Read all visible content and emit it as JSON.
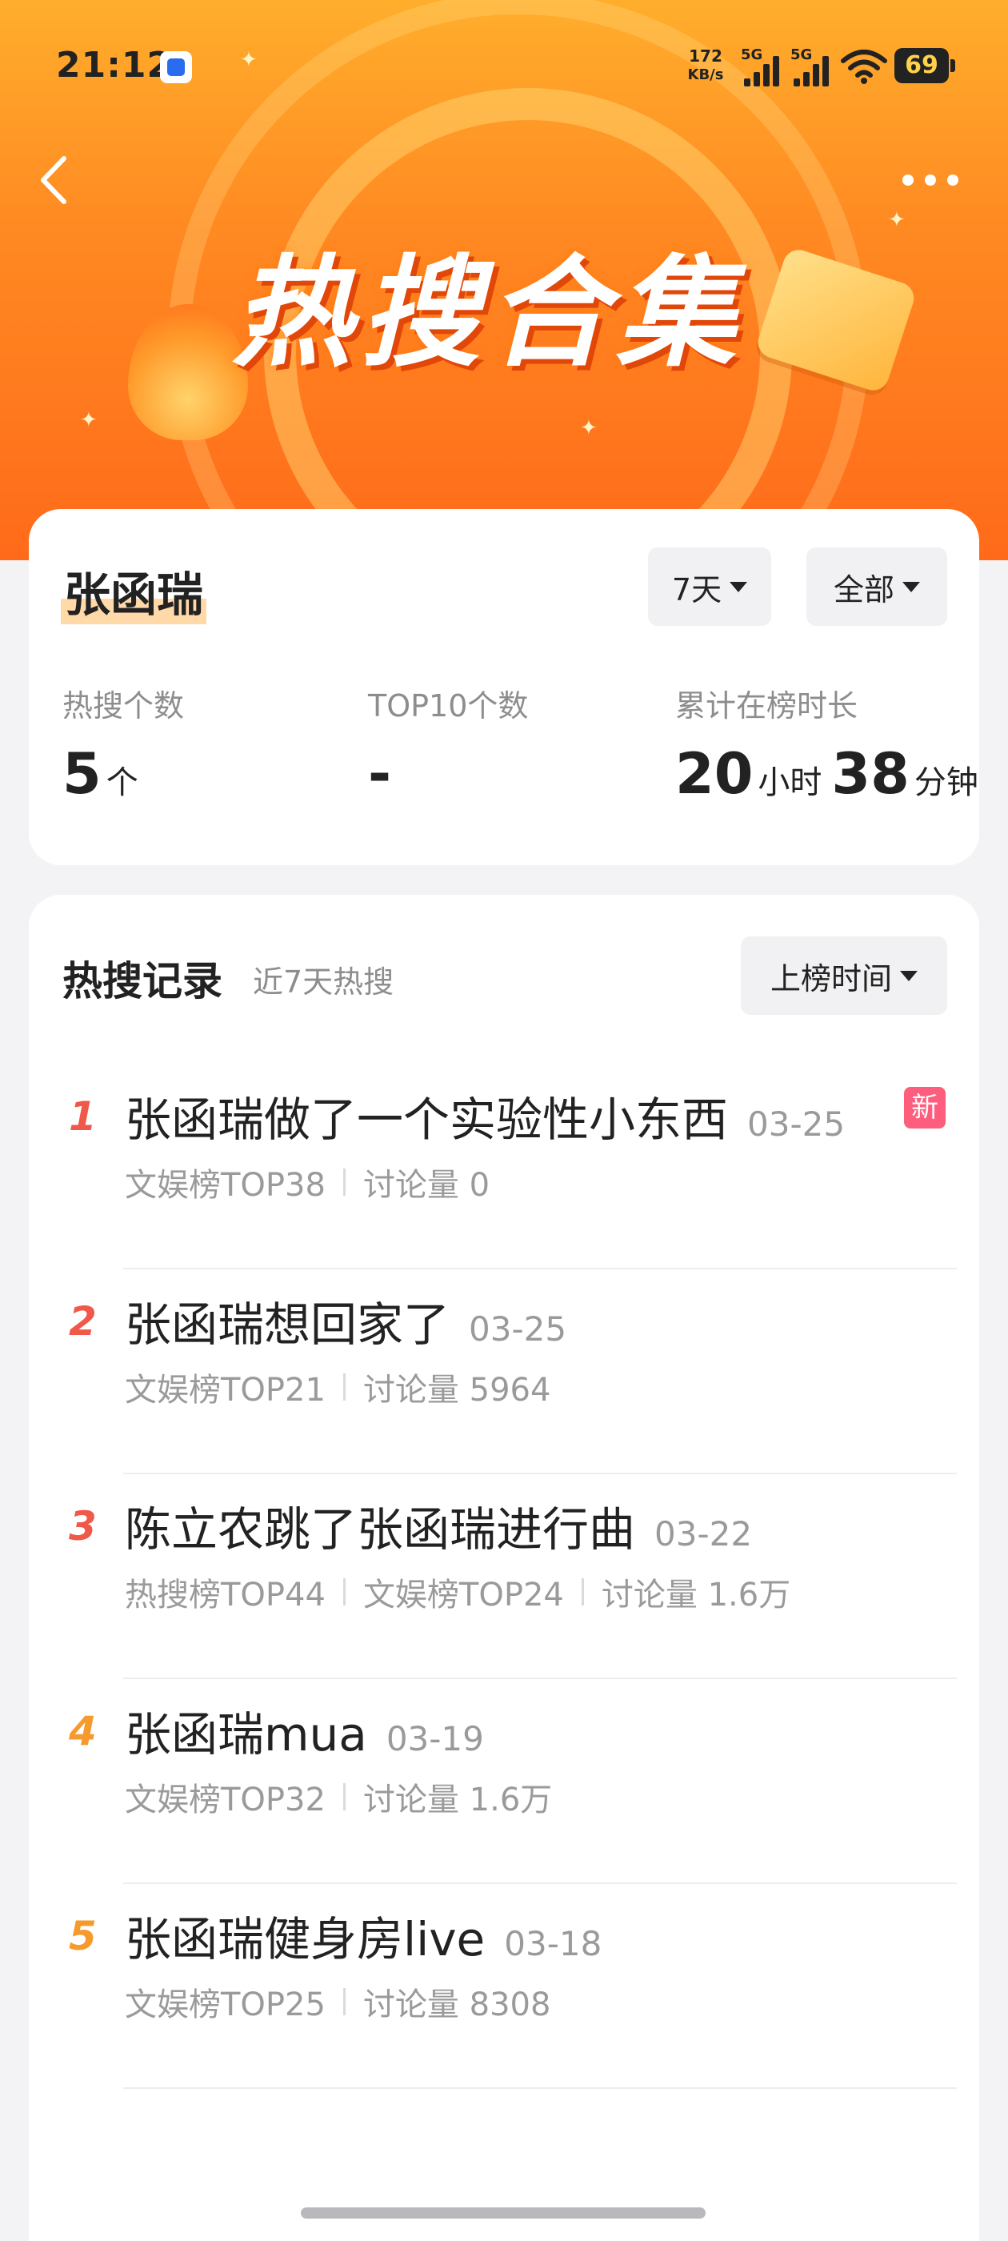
{
  "status_bar": {
    "time": "21:12",
    "net_speed": "172",
    "net_unit": "KB/s",
    "sig1": "5G",
    "sig2": "5G",
    "battery": "69"
  },
  "banner": {
    "title": "热搜合集"
  },
  "profile": {
    "name": "张函瑞",
    "range_filter": "7天",
    "type_filter": "全部",
    "stats": [
      {
        "label": "热搜个数",
        "value": "5",
        "unit": "个"
      },
      {
        "label": "TOP10个数",
        "value": "-"
      },
      {
        "label": "累计在榜时长",
        "hours": "20",
        "hours_unit": "小时",
        "minutes": "38",
        "minutes_unit": "分钟"
      }
    ]
  },
  "records": {
    "title": "热搜记录",
    "subtitle": "近7天热搜",
    "sort_label": "上榜时间",
    "items": [
      {
        "rank": "1",
        "title": "张函瑞做了一个实验性小东西",
        "date": "03-25",
        "badge": "新",
        "meta": [
          "文娱榜TOP38",
          "讨论量 0"
        ]
      },
      {
        "rank": "2",
        "title": "张函瑞想回家了",
        "date": "03-25",
        "meta": [
          "文娱榜TOP21",
          "讨论量 5964"
        ]
      },
      {
        "rank": "3",
        "title": "陈立农跳了张函瑞进行曲",
        "date": "03-22",
        "meta": [
          "热搜榜TOP44",
          "文娱榜TOP24",
          "讨论量 1.6万"
        ]
      },
      {
        "rank": "4",
        "title": "张函瑞mua",
        "date": "03-19",
        "meta": [
          "文娱榜TOP32",
          "讨论量 1.6万"
        ]
      },
      {
        "rank": "5",
        "title": "张函瑞健身房live",
        "date": "03-18",
        "meta": [
          "文娱榜TOP25",
          "讨论量 8308"
        ]
      }
    ]
  },
  "colors": {
    "rank_red": "#f0584a",
    "rank_orange": "#f79a2e",
    "badge_pink": "#ff5d7d",
    "hero_orange": "#ff7a1e"
  }
}
